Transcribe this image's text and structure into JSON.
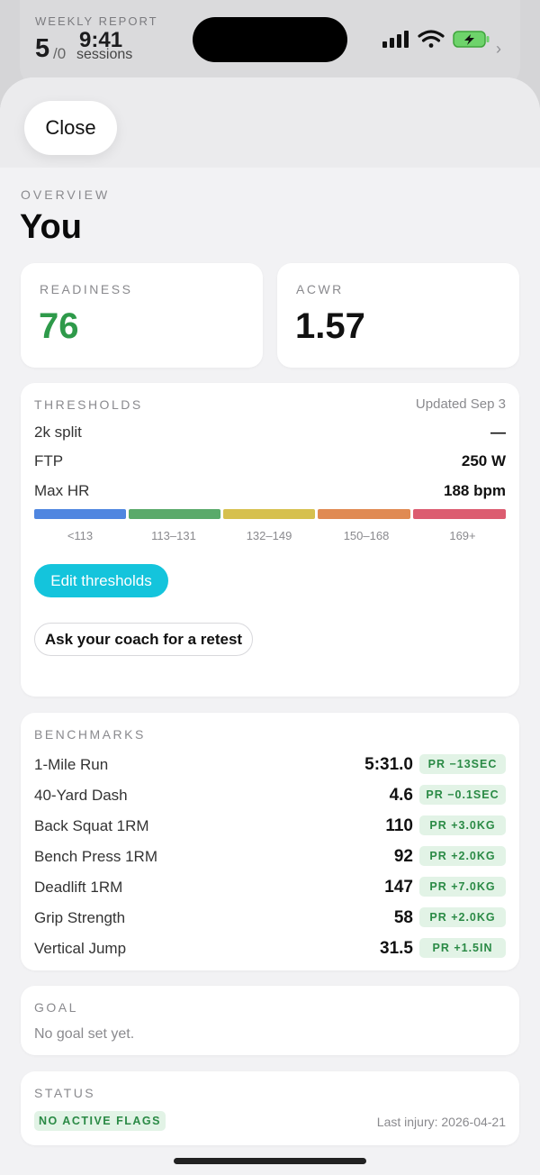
{
  "widget": {
    "label": "WEEKLY REPORT",
    "sessions_done": "5",
    "sessions_total": "/0",
    "time": "9:41",
    "sessions_word": "sessions"
  },
  "sheet": {
    "close_label": "Close",
    "overview_label": "OVERVIEW",
    "title": "You"
  },
  "metrics": {
    "readiness_label": "READINESS",
    "readiness_value": "76",
    "readiness_color": "#2e9a4a",
    "acwr_label": "ACWR",
    "acwr_value": "1.57"
  },
  "thresholds": {
    "label": "THRESHOLDS",
    "updated": "Updated Sep 3",
    "rows": [
      {
        "label": "2k split",
        "value": "—"
      },
      {
        "label": "FTP",
        "value": "250 W"
      },
      {
        "label": "Max HR",
        "value": "188 bpm"
      }
    ],
    "zones": [
      {
        "label": "<113",
        "color": "#4f86e0"
      },
      {
        "label": "113–131",
        "color": "#5aaa6a"
      },
      {
        "label": "132–149",
        "color": "#d6c04e"
      },
      {
        "label": "150–168",
        "color": "#e08a52"
      },
      {
        "label": "169+",
        "color": "#dc5c70"
      }
    ],
    "edit_label": "Edit thresholds",
    "retest_label": "Ask your coach for a retest"
  },
  "benchmarks": {
    "label": "BENCHMARKS",
    "items": [
      {
        "label": "1-Mile Run",
        "value": "5:31.0",
        "pr": "PR −13SEC"
      },
      {
        "label": "40-Yard Dash",
        "value": "4.6",
        "pr": "PR −0.1SEC"
      },
      {
        "label": "Back Squat 1RM",
        "value": "110",
        "pr": "PR +3.0KG"
      },
      {
        "label": "Bench Press 1RM",
        "value": "92",
        "pr": "PR +2.0KG"
      },
      {
        "label": "Deadlift 1RM",
        "value": "147",
        "pr": "PR +7.0KG"
      },
      {
        "label": "Grip Strength",
        "value": "58",
        "pr": "PR +2.0KG"
      },
      {
        "label": "Vertical Jump",
        "value": "31.5",
        "pr": "PR +1.5IN"
      }
    ]
  },
  "goal": {
    "label": "GOAL",
    "text": "No goal set yet."
  },
  "status": {
    "label": "STATUS",
    "flag": "NO ACTIVE FLAGS",
    "last_injury": "Last injury: 2026-04-21"
  }
}
